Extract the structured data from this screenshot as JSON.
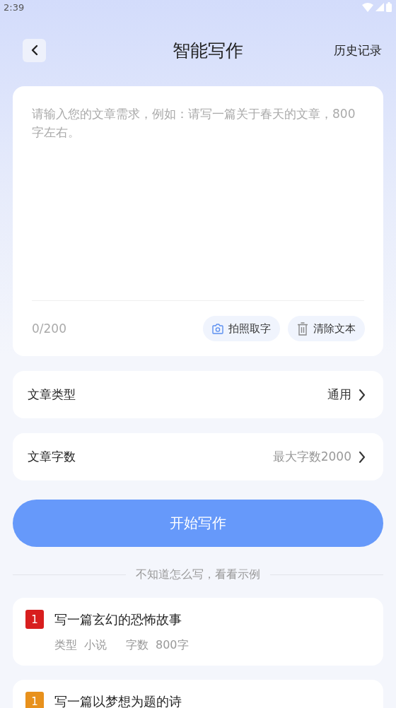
{
  "status_bar": {
    "time": "2:39"
  },
  "header": {
    "title": "智能写作",
    "history": "历史记录"
  },
  "editor": {
    "placeholder": "请输入您的文章需求，例如：请写一篇关于春天的文章，800字左右。",
    "counter": "0/200",
    "actions": [
      {
        "kind": "camera",
        "label": "拍照取字"
      },
      {
        "kind": "trash",
        "label": "清除文本"
      }
    ]
  },
  "settings": [
    {
      "label": "文章类型",
      "value": "通用",
      "muted": false
    },
    {
      "label": "文章字数",
      "value": "最大字数2000",
      "muted": true
    }
  ],
  "start_button": "开始写作",
  "examples_divider": "不知道怎么写，看看示例",
  "examples": [
    {
      "rank": "1",
      "color": "#d81e1e",
      "title": "写一篇玄幻的恐怖故事",
      "type_label": "类型",
      "type": "小说",
      "count_label": "字数",
      "count": "800字"
    },
    {
      "rank": "1",
      "color": "#e8911c",
      "title": "写一篇以梦想为题的诗"
    }
  ]
}
